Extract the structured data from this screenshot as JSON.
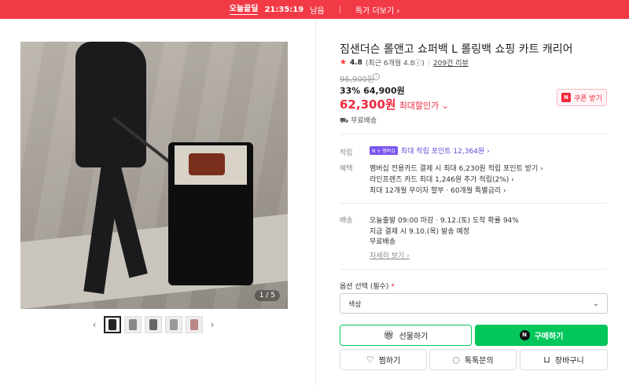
{
  "banner": {
    "brand": "오늘끝딜",
    "timer": "21:35:19",
    "timer_suffix": "남음",
    "link": "특가 더보기 ›"
  },
  "product": {
    "title": "짐샌더슨 롤앤고 쇼퍼백 L 롤링백 쇼핑 카트 캐리어",
    "rating": "4.8",
    "rating_detail": "(최근 6개월 4.8ⓘ)",
    "reviews": "209건 리뷰",
    "original_price": "96,900원",
    "discount": "33% 64,900원",
    "final_price": "62,300원",
    "final_label": "최대할인가 ⌄",
    "coupon": "쿠폰 받기",
    "coupon_badge": "N",
    "shipping_free": "무료배송",
    "image_counter": "1 / 5"
  },
  "points": {
    "label": "적립",
    "badge": "N + 멤버십",
    "text": "최대 적립 포인트 12,364원 ›"
  },
  "benefits": {
    "label": "혜택",
    "lines": [
      "멤버십 전용카드 결제 시 최대 6,230원 적립 포인트 받기 ›",
      "라인프렌즈 카드 최대 1,246원 추가 적립(2%) ›",
      "최대 12개월 무이자 할부 · 60개월 특별금리 ›"
    ]
  },
  "delivery": {
    "label": "배송",
    "lines": [
      "오늘출발 09:00 마감 · 9.12.(토) 도착 확률 94%",
      "지금 결제 시 9.10.(목) 발송 예정",
      "무료배송"
    ],
    "more": "자세히 보기 ›"
  },
  "option": {
    "label": "옵션 선택 (필수)",
    "required": "*",
    "selected": "색상"
  },
  "actions": {
    "gift": "선물하기",
    "buy": "구매하기",
    "wish": "찜하기",
    "talk": "톡톡문의",
    "cart": "장바구니"
  },
  "colors": {
    "accent": "#f0283c",
    "naver_green": "#03c75a",
    "banner": "#f23a46",
    "point_purple": "#6a45d6"
  }
}
